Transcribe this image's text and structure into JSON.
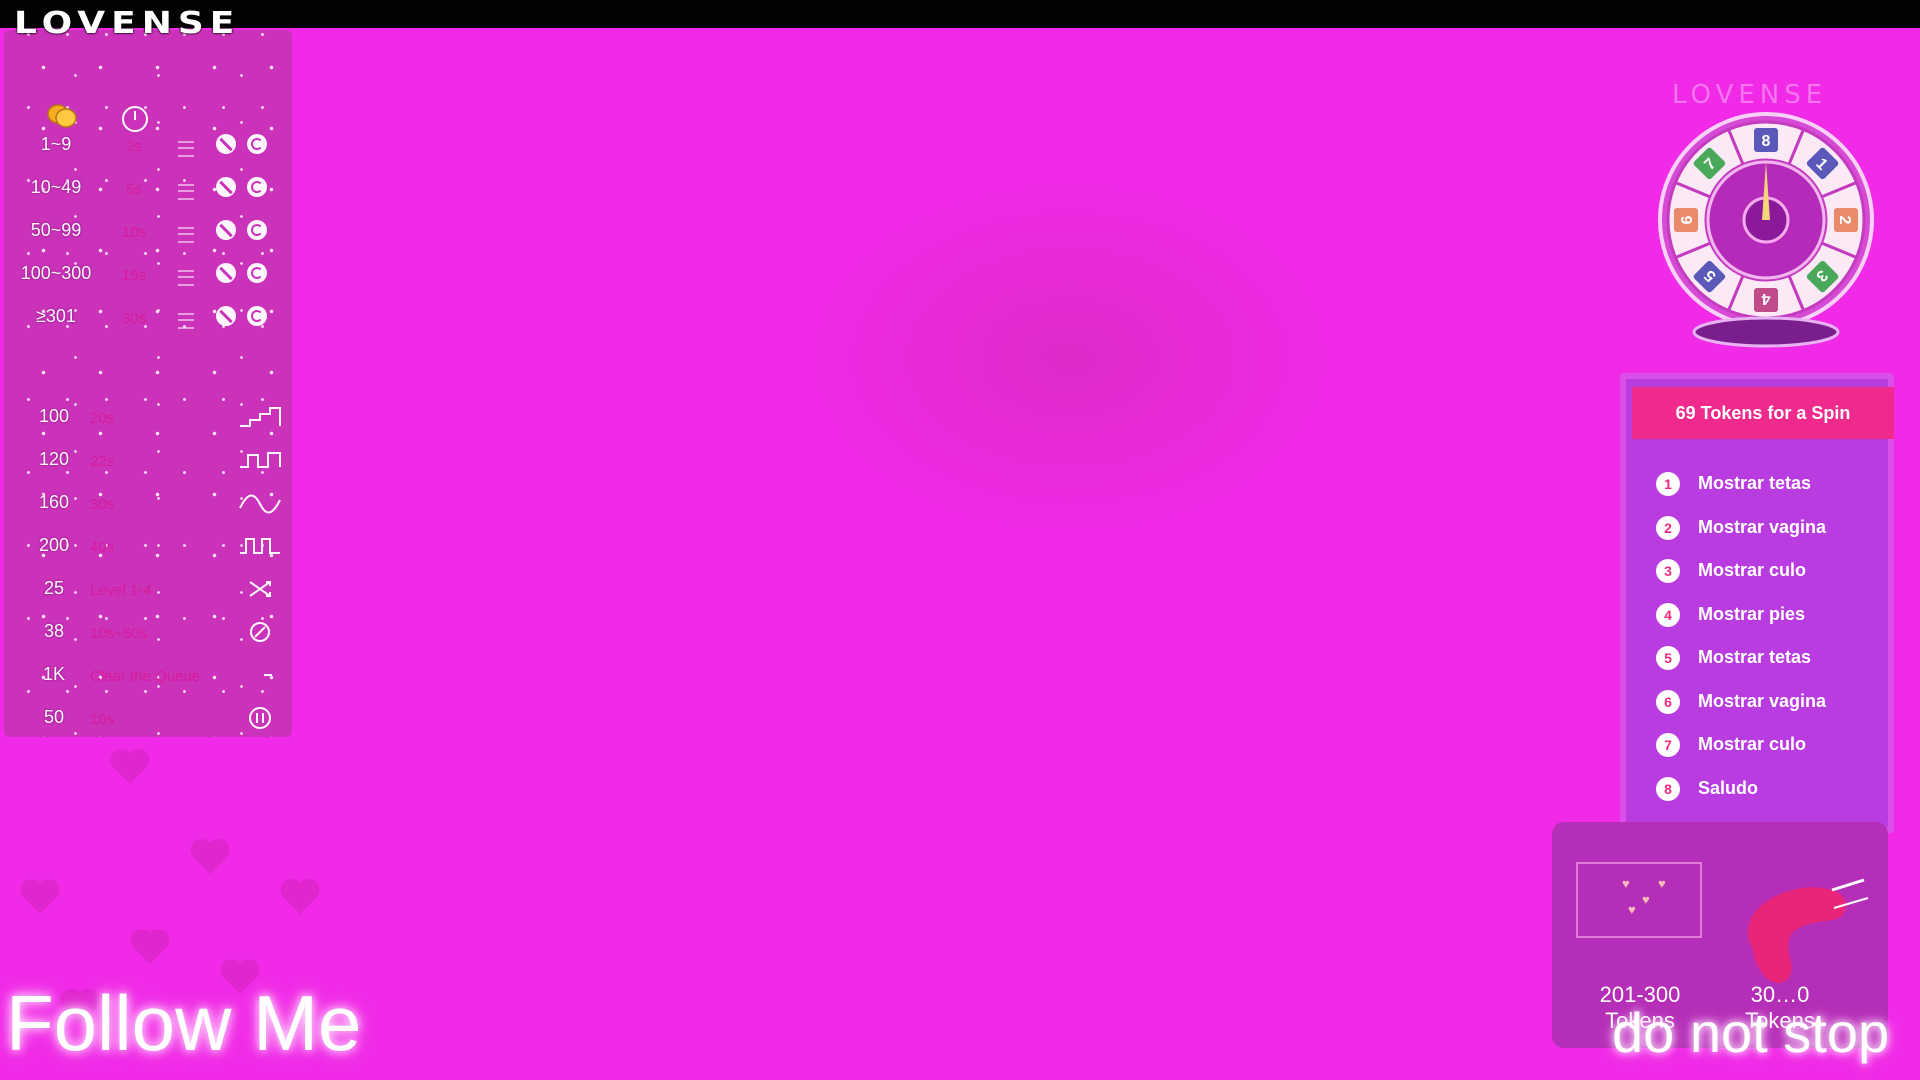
{
  "brand": "LOVENSE",
  "colors": {
    "background": "#f02ae6",
    "panel": "#c934b8",
    "accent_pink": "#f02a8c",
    "spin_card": "#b83ce0",
    "duration_text": "#d81a9a"
  },
  "levels_panel": {
    "header_icons": [
      "coins-icon",
      "clock-icon"
    ],
    "rows": [
      {
        "range": "1~9",
        "duration": "2s"
      },
      {
        "range": "10~49",
        "duration": "5s"
      },
      {
        "range": "50~99",
        "duration": "10s"
      },
      {
        "range": "100~300",
        "duration": "15s"
      },
      {
        "range": "≥301",
        "duration": "30s"
      }
    ],
    "patterns": [
      {
        "amount": "100",
        "duration": "20s",
        "icon": "stairs-pattern-icon"
      },
      {
        "amount": "120",
        "duration": "22s",
        "icon": "step-wave-icon"
      },
      {
        "amount": "160",
        "duration": "30s",
        "icon": "sine-wave-icon"
      },
      {
        "amount": "200",
        "duration": "40s",
        "icon": "square-wave-icon"
      },
      {
        "amount": "25",
        "duration": "Level 1-4",
        "icon": "shuffle-icon"
      },
      {
        "amount": "38",
        "duration": "10s~50s",
        "icon": "random-timer-icon"
      },
      {
        "amount": "1K",
        "duration": "Clear the Queue",
        "icon": "clear-queue-icon"
      },
      {
        "amount": "50",
        "duration": "10s",
        "icon": "pause-icon"
      }
    ]
  },
  "overlay_text": {
    "follow": "Follow Me",
    "do_not_stop": "do not stop"
  },
  "wheel": {
    "logo": "LOVENSE",
    "segments": [
      "1",
      "2",
      "3",
      "4",
      "5",
      "6",
      "7",
      "8"
    ]
  },
  "spin": {
    "header": "69 Tokens for a Spin",
    "items": [
      {
        "num": "1",
        "label": "Mostrar tetas"
      },
      {
        "num": "2",
        "label": "Mostrar vagina"
      },
      {
        "num": "3",
        "label": "Mostrar culo"
      },
      {
        "num": "4",
        "label": "Mostrar pies"
      },
      {
        "num": "5",
        "label": "Mostrar tetas"
      },
      {
        "num": "6",
        "label": "Mostrar vagina"
      },
      {
        "num": "7",
        "label": "Mostrar culo"
      },
      {
        "num": "8",
        "label": "Saludo"
      }
    ]
  },
  "tip": {
    "range_left": "201-300",
    "tokens_left": "Tokens",
    "range_right": "30…0",
    "tokens_right": "Tokens"
  }
}
